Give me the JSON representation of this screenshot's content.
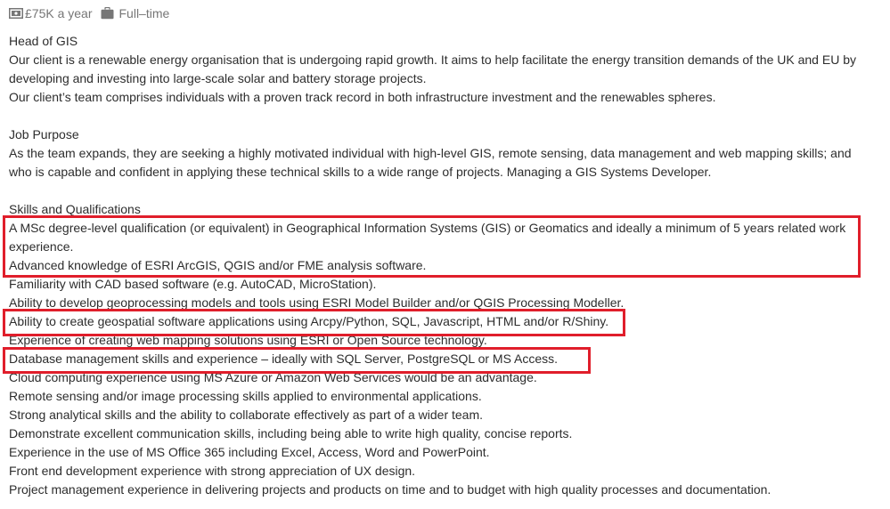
{
  "header": {
    "salary": "£75K a year",
    "job_type": "Full–time",
    "salary_icon": "money-icon",
    "job_type_icon": "briefcase-icon"
  },
  "description": {
    "title": "Head of GIS",
    "intro": [
      "Our client is a renewable energy organisation that is undergoing rapid growth. It aims to help facilitate the energy transition demands of the UK and EU by developing and investing into large-scale solar and battery storage projects.",
      "Our client’s team comprises individuals with a proven track record in both infrastructure investment and the renewables spheres."
    ],
    "purpose_heading": "Job Purpose",
    "purpose_text": "As the team expands, they are seeking a highly motivated individual with high-level GIS, remote sensing, data management and web mapping skills; and who is capable and confident in applying these technical skills to a wide range of projects. Managing a GIS Systems Developer.",
    "skills_heading": "Skills and Qualifications",
    "skills": [
      "A MSc degree-level qualification (or equivalent) in Geographical Information Systems (GIS) or Geomatics and ideally a minimum of 5 years related work experience.",
      "Advanced knowledge of ESRI ArcGIS, QGIS and/or FME analysis software.",
      "Familiarity with CAD based software (e.g. AutoCAD, MicroStation).",
      "Ability to develop geoprocessing models and tools using ESRI Model Builder and/or QGIS Processing Modeller.",
      "Ability to create geospatial software applications using Arcpy/Python, SQL, Javascript, HTML and/or R/Shiny.",
      "Experience of creating web mapping solutions using ESRI or Open Source technology.",
      "Database management skills and experience – ideally with SQL Server, PostgreSQL or MS Access.",
      "Cloud computing experience using MS Azure or Amazon Web Services would be an advantage.",
      "Remote sensing and/or image processing skills applied to environmental applications.",
      "Strong analytical skills and the ability to collaborate effectively as part of a wider team.",
      "Demonstrate excellent communication skills, including being able to write high quality, concise reports.",
      "Experience in the use of MS Office 365 including Excel, Access, Word and PowerPoint.",
      "Front end development experience with strong appreciation of UX design.",
      "Project management experience in delivering projects and products on time and to budget with high quality processes and documentation."
    ]
  },
  "annotations": {
    "highlight_color": "#e01e2b"
  }
}
